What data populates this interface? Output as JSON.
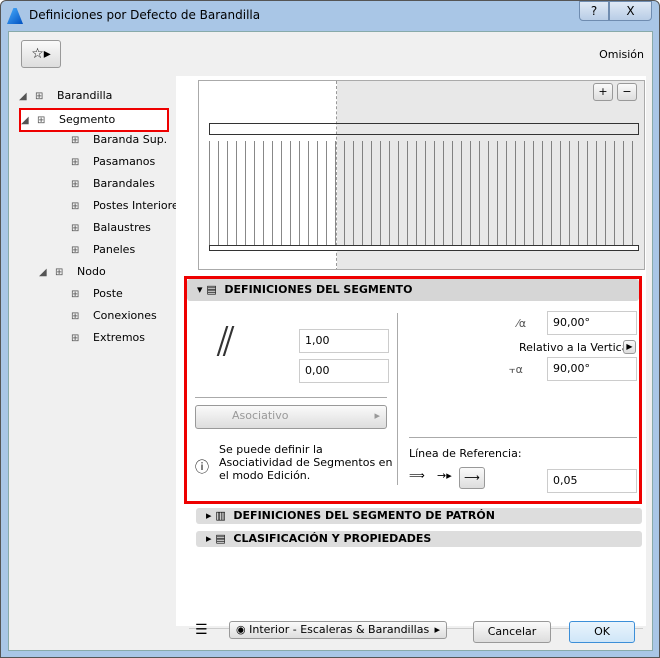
{
  "window": {
    "title": "Definiciones por Defecto de Barandilla",
    "help": "?",
    "close": "X"
  },
  "header": {
    "status": "Omisión"
  },
  "tree": [
    {
      "label": "Barandilla",
      "level": 0,
      "expanded": true
    },
    {
      "label": "Segmento",
      "level": 1,
      "expanded": true,
      "selected": true
    },
    {
      "label": "Baranda Sup.",
      "level": 2
    },
    {
      "label": "Pasamanos",
      "level": 2
    },
    {
      "label": "Barandales",
      "level": 2
    },
    {
      "label": "Postes Interiores",
      "level": 2
    },
    {
      "label": "Balaustres",
      "level": 2
    },
    {
      "label": "Paneles",
      "level": 2
    },
    {
      "label": "Nodo",
      "level": 1,
      "expanded": true
    },
    {
      "label": "Poste",
      "level": 2
    },
    {
      "label": "Conexiones",
      "level": 2
    },
    {
      "label": "Extremos",
      "level": 2
    }
  ],
  "preview": {
    "zoom_in": "+",
    "zoom_out": "−"
  },
  "segment": {
    "title": "DEFINICIONES DEL SEGMENTO",
    "height": "1,00",
    "offset": "0,00",
    "angle1": "90,00°",
    "relative": "Relativo a la Vertical",
    "angle2": "90,00°",
    "assoc": "Asociativo",
    "info": "Se puede definir la Asociatividad de Segmentos en el modo Edición.",
    "refline_label": "Línea de Referencia:",
    "refline_value": "0,05"
  },
  "sections": [
    "DEFINICIONES DEL SEGMENTO DE PATRÓN",
    "CLASIFICACIÓN Y PROPIEDADES"
  ],
  "footer": {
    "layer": "Interior - Escaleras & Barandillas",
    "cancel": "Cancelar",
    "ok": "OK"
  }
}
